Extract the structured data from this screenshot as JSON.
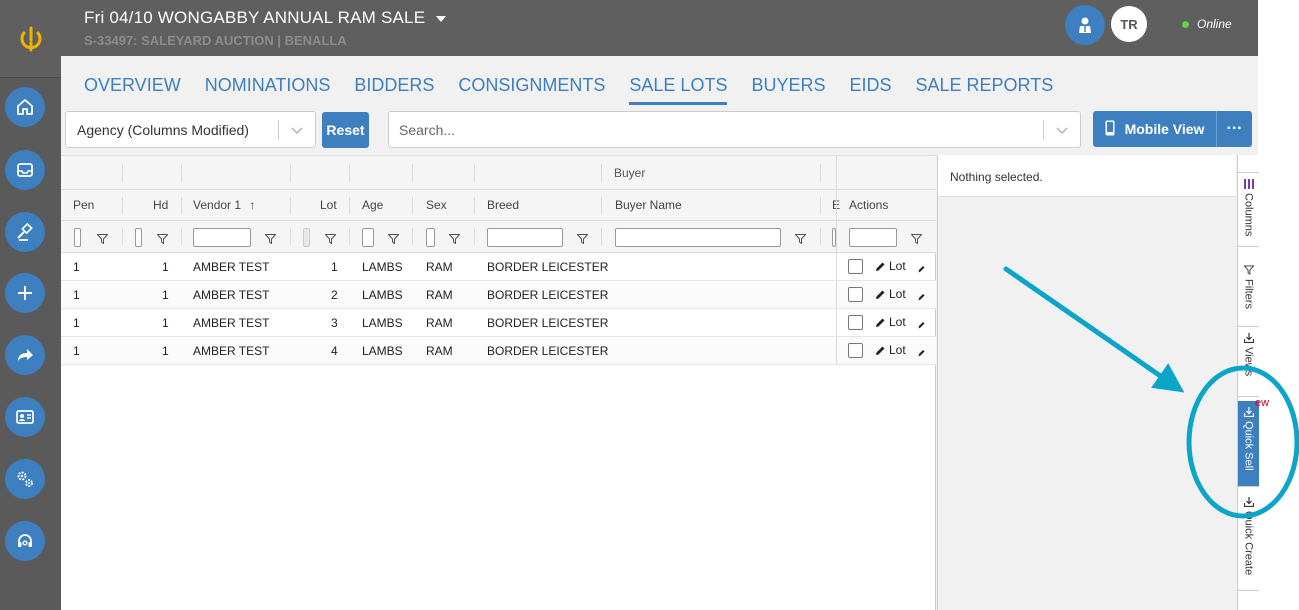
{
  "header": {
    "sale_title": "Fri 04/10 WONGABBY ANNUAL RAM SALE",
    "sale_subtitle": "S-33497: SALEYARD AUCTION | BENALLA",
    "avatar_initials": "TR",
    "status": "Online"
  },
  "tabs": [
    "OVERVIEW",
    "NOMINATIONS",
    "BIDDERS",
    "CONSIGNMENTS",
    "SALE LOTS",
    "BUYERS",
    "EIDS",
    "SALE REPORTS"
  ],
  "active_tab": "SALE LOTS",
  "toolbar": {
    "view_select": "Agency (Columns Modified)",
    "reset_label": "Reset",
    "search_placeholder": "Search...",
    "mobile_view_label": "Mobile View",
    "more_label": "···"
  },
  "grid": {
    "group_header": "Buyer",
    "columns": {
      "pen": "Pen",
      "hd": "Hd",
      "vendor": "Vendor 1",
      "vendor_sort": "↑",
      "lot": "Lot",
      "age": "Age",
      "sex": "Sex",
      "breed": "Breed",
      "buyer_name": "Buyer Name",
      "extra": "E",
      "actions": "Actions"
    },
    "action_label": "Lot",
    "rows": [
      {
        "pen": "1",
        "hd": "1",
        "vendor": "AMBER TEST",
        "lot": "1",
        "age": "LAMBS",
        "sex": "RAM",
        "breed": "BORDER LEICESTER",
        "buyer_name": ""
      },
      {
        "pen": "1",
        "hd": "1",
        "vendor": "AMBER TEST",
        "lot": "2",
        "age": "LAMBS",
        "sex": "RAM",
        "breed": "BORDER LEICESTER",
        "buyer_name": ""
      },
      {
        "pen": "1",
        "hd": "1",
        "vendor": "AMBER TEST",
        "lot": "3",
        "age": "LAMBS",
        "sex": "RAM",
        "breed": "BORDER LEICESTER",
        "buyer_name": ""
      },
      {
        "pen": "1",
        "hd": "1",
        "vendor": "AMBER TEST",
        "lot": "4",
        "age": "LAMBS",
        "sex": "RAM",
        "breed": "BORDER LEICESTER",
        "buyer_name": ""
      }
    ]
  },
  "side_panel": {
    "nothing_selected": "Nothing selected.",
    "tabs": [
      "Columns",
      "Filters",
      "Views",
      "Quick Sell",
      "Quick Create"
    ],
    "active_tab": "Quick Sell",
    "new_badge": "ew"
  },
  "rail": {
    "icons": [
      "logo-icon",
      "home-icon",
      "inbox-icon",
      "gavel-icon",
      "plus-icon",
      "share-icon",
      "id-card-icon",
      "settings-icon",
      "support-icon"
    ]
  },
  "colors": {
    "accent": "#3d7fbf",
    "header_bg": "#5f5f5f",
    "annotation": "#0aa5c8",
    "logo": "#f0b400"
  }
}
